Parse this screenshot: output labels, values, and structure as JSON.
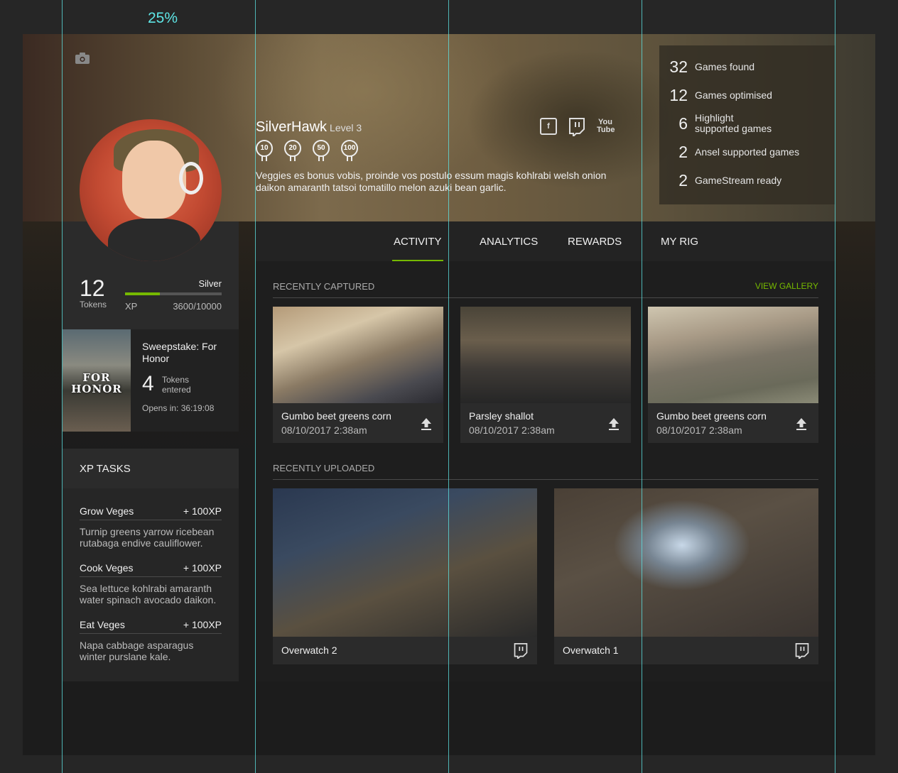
{
  "guide_label": "25%",
  "profile": {
    "username": "SilverHawk",
    "level": "Level 3",
    "badges": [
      "10",
      "20",
      "50",
      "100"
    ],
    "bio": "Veggies es bonus vobis, proinde vos postulo essum magis kohlrabi welsh onion daikon amaranth tatsoi tomatillo melon azuki bean garlic."
  },
  "socials": [
    "facebook-icon",
    "twitch-icon",
    "youtube-icon"
  ],
  "youtube_text": "You Tube",
  "stats": [
    {
      "n": "32",
      "l": "Games found"
    },
    {
      "n": "12",
      "l": "Games optimised"
    },
    {
      "n": "6",
      "l": "Highlight supported games"
    },
    {
      "n": "2",
      "l": "Ansel supported games"
    },
    {
      "n": "2",
      "l": "GameStream ready"
    }
  ],
  "xp": {
    "tokens": "12",
    "tokens_label": "Tokens",
    "tier": "Silver",
    "xp_label": "XP",
    "xp_value": "3600/10000",
    "progress": 0.36
  },
  "sweepstake": {
    "title": "Sweepstake: For Honor",
    "art_text": "FOR HONOR",
    "tokens": "4",
    "tokens_label": "Tokens entered",
    "opens": "Opens in: 36:19:08"
  },
  "tasks_title": "XP TASKS",
  "tasks": [
    {
      "name": "Grow Veges",
      "xp": "+ 100XP",
      "desc": "Turnip greens yarrow ricebean rutabaga endive cauliflower."
    },
    {
      "name": "Cook Veges",
      "xp": "+ 100XP",
      "desc": "Sea lettuce kohlrabi amaranth water spinach avocado daikon."
    },
    {
      "name": "Eat Veges",
      "xp": "+ 100XP",
      "desc": "Napa cabbage asparagus winter purslane kale."
    }
  ],
  "tabs": [
    "ACTIVITY",
    "ANALYTICS",
    "REWARDS",
    "MY RIG"
  ],
  "recently_captured": {
    "title": "RECENTLY CAPTURED",
    "view_gallery": "VIEW GALLERY",
    "items": [
      {
        "title": "Gumbo beet greens corn",
        "date": "08/10/2017  2:38am"
      },
      {
        "title": "Parsley shallot",
        "date": "08/10/2017  2:38am"
      },
      {
        "title": "Gumbo beet greens corn",
        "date": "08/10/2017  2:38am"
      }
    ]
  },
  "recently_uploaded": {
    "title": "RECENTLY UPLOADED",
    "items": [
      {
        "title": "Overwatch 2"
      },
      {
        "title": "Overwatch 1"
      }
    ]
  },
  "colors": {
    "accent": "#76b900",
    "guide": "#5ee6e6"
  }
}
